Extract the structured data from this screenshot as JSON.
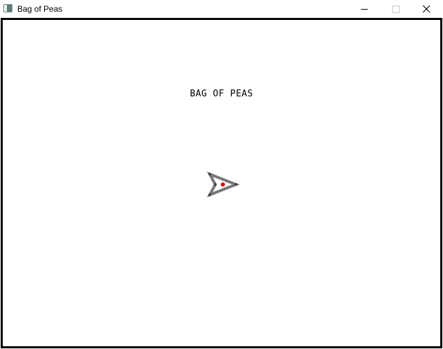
{
  "window": {
    "title": "Bag of Peas",
    "icon": "app-window-icon",
    "controls": {
      "minimize_icon": "minimize-icon",
      "maximize_icon": "maximize-icon",
      "close_icon": "close-icon"
    }
  },
  "game": {
    "title": "BAG OF PEAS",
    "player": {
      "icon": "arrowhead-ship-icon",
      "hull_color": "#777777",
      "vertex_color": "#444444",
      "core_color": "#e00000"
    }
  }
}
